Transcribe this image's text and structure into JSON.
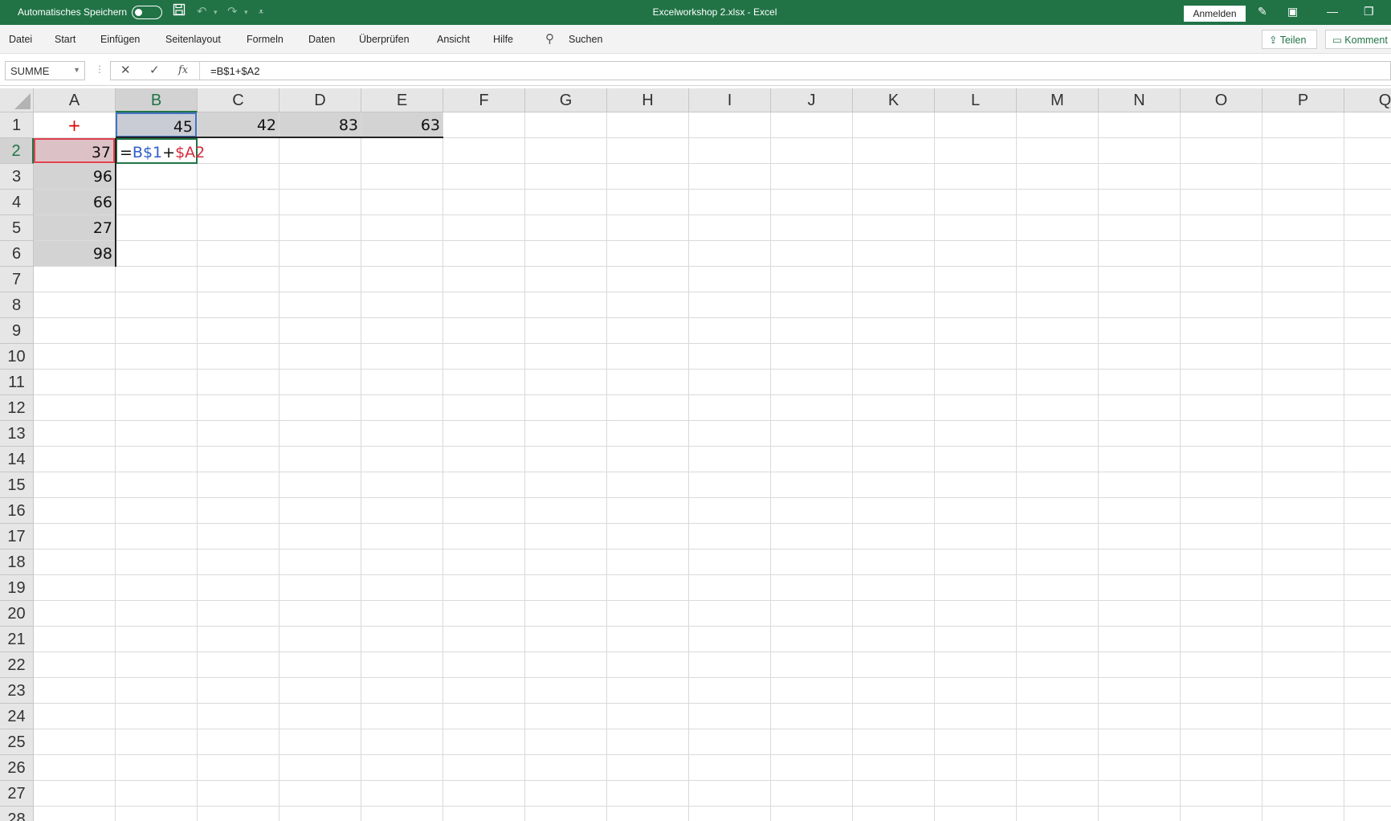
{
  "titlebar": {
    "autosave_label": "Automatisches Speichern",
    "document_title": "Excelworkshop 2.xlsx  -  Excel",
    "signin_label": "Anmelden"
  },
  "ribbon": {
    "tabs": [
      "Datei",
      "Start",
      "Einfügen",
      "Seitenlayout",
      "Formeln",
      "Daten",
      "Überprüfen",
      "Ansicht",
      "Hilfe"
    ],
    "search_label": "Suchen",
    "share_label": "Teilen",
    "comment_label": "Komment"
  },
  "formula_bar": {
    "name_box": "SUMME",
    "fx_label": "fx",
    "formula": "=B$1+$A2"
  },
  "sheet": {
    "columns": [
      "A",
      "B",
      "C",
      "D",
      "E",
      "F",
      "G",
      "H",
      "I",
      "J",
      "K",
      "L",
      "M",
      "N",
      "O",
      "P",
      "Q"
    ],
    "rows": [
      "1",
      "2",
      "3",
      "4",
      "5",
      "6",
      "7",
      "8",
      "9",
      "10",
      "11",
      "12",
      "13",
      "14",
      "15",
      "16",
      "17",
      "18",
      "19",
      "20",
      "21",
      "22",
      "23",
      "24",
      "25",
      "26",
      "27",
      "28"
    ],
    "active_column": "B",
    "active_row": "2",
    "cells": {
      "A1": "+",
      "B1": "45",
      "C1": "42",
      "D1": "83",
      "E1": "63",
      "A2": "37",
      "A3": "96",
      "A4": "66",
      "A5": "27",
      "A6": "98"
    },
    "edit_cell": {
      "address": "B2",
      "eq": "=",
      "ref1": "B$1",
      "op": "+",
      "ref2": "$A2"
    }
  },
  "colors": {
    "brand": "#217346",
    "ref_blue": "#2f5ec9",
    "ref_red": "#d62a3a"
  }
}
